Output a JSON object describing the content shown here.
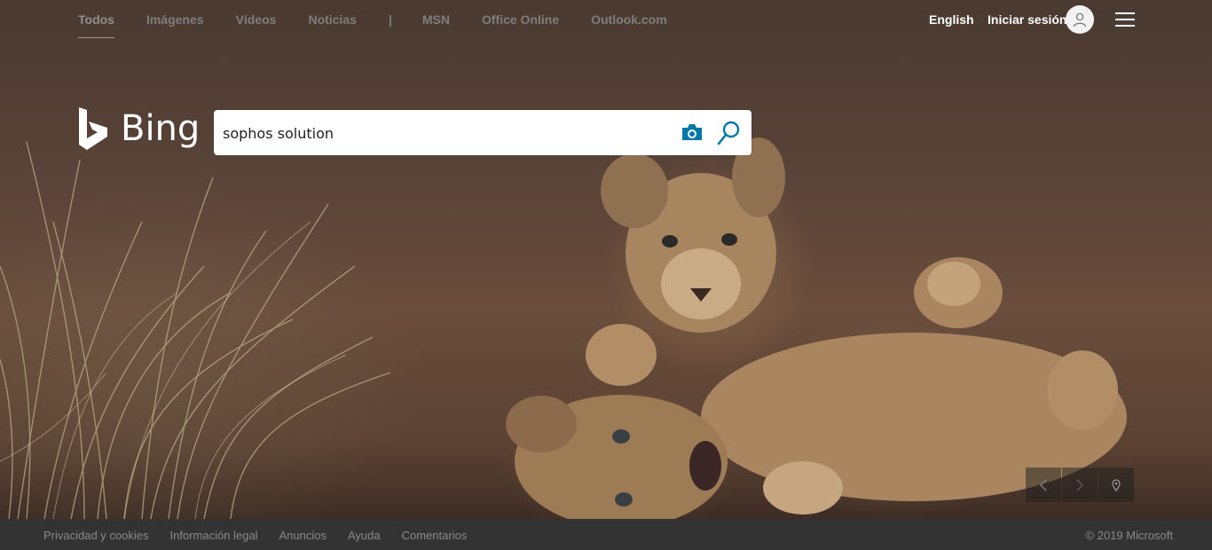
{
  "nav": {
    "items": [
      {
        "label": "Todos",
        "active": true
      },
      {
        "label": "Imágenes"
      },
      {
        "label": "Vídeos"
      },
      {
        "label": "Noticias"
      }
    ],
    "separator": "|",
    "external": [
      {
        "label": "MSN"
      },
      {
        "label": "Office Online"
      },
      {
        "label": "Outlook.com"
      }
    ],
    "language": "English",
    "signin": "Iniciar sesión"
  },
  "logo": {
    "text": "Bing"
  },
  "search": {
    "value": "sophos solution"
  },
  "icons": {
    "camera": "camera-icon",
    "search": "magnifier-icon",
    "user": "user-icon",
    "menu": "hamburger-icon",
    "prev": "chevron-left-icon",
    "next": "chevron-right-icon",
    "location": "location-pin-icon"
  },
  "colors": {
    "accent": "#0078a8",
    "footer_bg": "#333333"
  },
  "footer": {
    "links": [
      "Privacidad y cookies",
      "Información legal",
      "Anuncios",
      "Ayuda",
      "Comentarios"
    ],
    "copyright": "© 2019 Microsoft"
  }
}
